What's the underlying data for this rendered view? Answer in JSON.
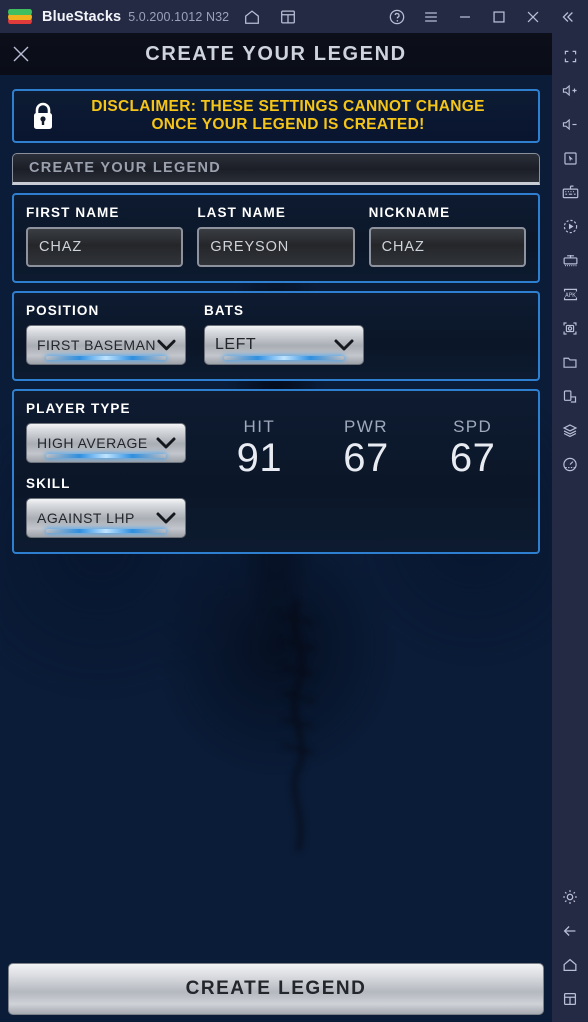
{
  "window": {
    "app_name": "BlueStacks",
    "version": "5.0.200.1012 N32",
    "titlebar_icons": [
      "home-icon",
      "multi-instance-icon"
    ],
    "control_icons": [
      "help-icon",
      "menu-icon",
      "minimize-icon",
      "maximize-icon",
      "close-icon",
      "collapse-icon"
    ]
  },
  "rail": {
    "icons": [
      "fullscreen-icon",
      "volume-up-icon",
      "volume-down-icon",
      "pointer-icon",
      "keyboard-controls-icon",
      "macro-recorder-icon",
      "multi-instance-manager-icon",
      "install-apk-icon",
      "screenshot-icon",
      "media-folder-icon",
      "rotate-icon",
      "layers-icon",
      "performance-icon"
    ],
    "bottom_icons": [
      "settings-gear-icon",
      "back-arrow-icon",
      "home-icon",
      "recents-icon"
    ]
  },
  "modal": {
    "close_label": "✕",
    "title": "CREATE YOUR LEGEND"
  },
  "disclaimer": {
    "icon": "lock-icon",
    "line1": "DISCLAIMER: THESE SETTINGS CANNOT CHANGE",
    "line2": "ONCE YOUR LEGEND IS CREATED!",
    "color": "#f5c518"
  },
  "tabbar": {
    "label": "CREATE YOUR LEGEND"
  },
  "names_panel": {
    "fields": [
      {
        "label": "FIRST NAME",
        "value": "CHAZ",
        "placeholder": "FIRST NAME"
      },
      {
        "label": "LAST NAME",
        "value": "GREYSON",
        "placeholder": "LAST NAME"
      },
      {
        "label": "NICKNAME",
        "value": "CHAZ",
        "placeholder": "NICKNAME"
      }
    ]
  },
  "position_panel": {
    "fields": [
      {
        "label": "POSITION",
        "value": "FIRST BASEMAN",
        "chevron": "chevron-down-icon"
      },
      {
        "label": "BATS",
        "value": "LEFT",
        "chevron": "chevron-down-icon"
      }
    ]
  },
  "player_type_panel": {
    "player_type": {
      "label": "PLAYER TYPE",
      "value": "HIGH AVERAGE",
      "chevron": "chevron-down-icon"
    },
    "skill": {
      "label": "SKILL",
      "value": "AGAINST LHP",
      "chevron": "chevron-down-icon"
    },
    "stats": [
      {
        "key": "HIT",
        "value": "91"
      },
      {
        "key": "PWR",
        "value": "67"
      },
      {
        "key": "SPD",
        "value": "67"
      }
    ]
  },
  "cta": {
    "label": "CREATE LEGEND"
  },
  "colors": {
    "panel_border": "#2f7fd0",
    "accent_yellow": "#f5c518",
    "titlebar": "#252a44",
    "stage_bg": "#0b1c38"
  }
}
